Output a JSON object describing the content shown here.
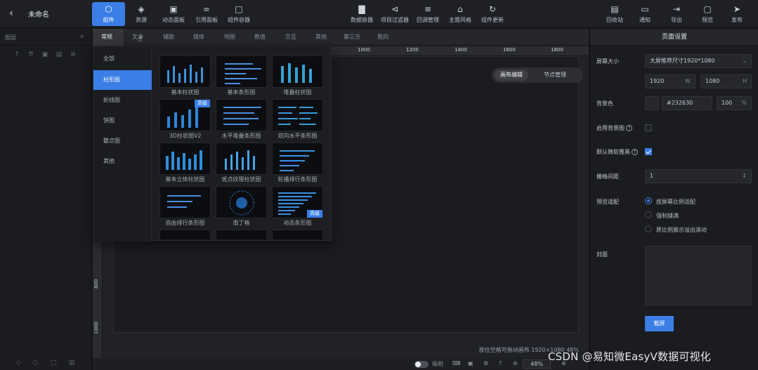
{
  "header": {
    "back_icon": "chevron-left-icon",
    "title": "未命名",
    "left_tools": [
      {
        "label": "组件",
        "icon": "component-icon",
        "active": true
      },
      {
        "label": "资源",
        "icon": "layers-icon"
      },
      {
        "label": "动态面板",
        "icon": "panel-icon"
      },
      {
        "label": "引用面板",
        "icon": "link-icon"
      },
      {
        "label": "组件容器",
        "icon": "container-icon"
      }
    ],
    "center_tools": [
      {
        "label": "数据容器",
        "icon": "chart-icon"
      },
      {
        "label": "项目过滤器",
        "icon": "filter-icon"
      },
      {
        "label": "回调管理",
        "icon": "sliders-icon"
      },
      {
        "label": "主题风格",
        "icon": "theme-icon"
      },
      {
        "label": "组件更新",
        "icon": "refresh-icon"
      }
    ],
    "right_tools": [
      {
        "label": "回收站",
        "icon": "trash-icon"
      },
      {
        "label": "通知",
        "icon": "message-icon"
      },
      {
        "label": "导出",
        "icon": "export-icon"
      },
      {
        "label": "预览",
        "icon": "preview-icon"
      },
      {
        "label": "发布",
        "icon": "send-icon"
      }
    ]
  },
  "layers": {
    "title": "图层",
    "search_icon": "search-icon"
  },
  "category_tabs": [
    "常规",
    "文本",
    "辅助",
    "媒体",
    "地图",
    "数值",
    "交互",
    "其他",
    "第三方",
    "我的"
  ],
  "ruler": {
    "ticks_top": [
      "1000",
      "1200",
      "1400",
      "1600",
      "1800"
    ],
    "ticks_left": [
      "800",
      "1000"
    ]
  },
  "subcategories": [
    "全部",
    "柱形图",
    "折线图",
    "饼图",
    "散点图",
    "其他"
  ],
  "active_subcategory": "柱形图",
  "components": [
    {
      "name": "基本柱状图"
    },
    {
      "name": "基本条形图"
    },
    {
      "name": "堆叠柱状图"
    },
    {
      "name": "3D柱状图V2",
      "badge": "高级"
    },
    {
      "name": "水平堆叠条形图"
    },
    {
      "name": "双向水平条形图"
    },
    {
      "name": "基本立体柱状图"
    },
    {
      "name": "斑点纹理柱状图"
    },
    {
      "name": "轮播排行条形图"
    },
    {
      "name": "自由排行条形图"
    },
    {
      "name": "南丁格"
    },
    {
      "name": "动态条形图",
      "badge2": "高级"
    }
  ],
  "view_toggle": {
    "options": [
      "画布编辑",
      "节点管理"
    ],
    "active": "画布编辑"
  },
  "canvas_status": "按住空格可拖动画布   1920×1080  48%",
  "bottom_bar": {
    "snap_label": "吸附",
    "zoom": "48%"
  },
  "page_settings": {
    "title": "页面设置",
    "screen_size_label": "屏幕大小",
    "screen_size_value": "大屏推荐尺寸1920*1080",
    "width": "1920",
    "width_unit": "W",
    "height": "1080",
    "height_unit": "H",
    "bg_color_label": "背景色",
    "bg_color_value": "#232630",
    "opacity": "100",
    "opacity_unit": "%",
    "bg_image_label": "启用背景图",
    "default_font_label": "默认微软雅黑",
    "grid_label": "栅格间距",
    "grid_value": "1",
    "scale_label": "预览适配",
    "scale_options": [
      "按屏幕比例适配",
      "强制铺满",
      "原比例展示溢出滚动"
    ],
    "scale_active": "按屏幕比例适配",
    "cover_label": "封面",
    "apply_label": "截屏"
  },
  "watermark": "CSDN @易知微EasyV数据可视化",
  "colors": {
    "accent": "#3a7ee6",
    "bg": "#17181c",
    "panel": "#1b1c20"
  }
}
